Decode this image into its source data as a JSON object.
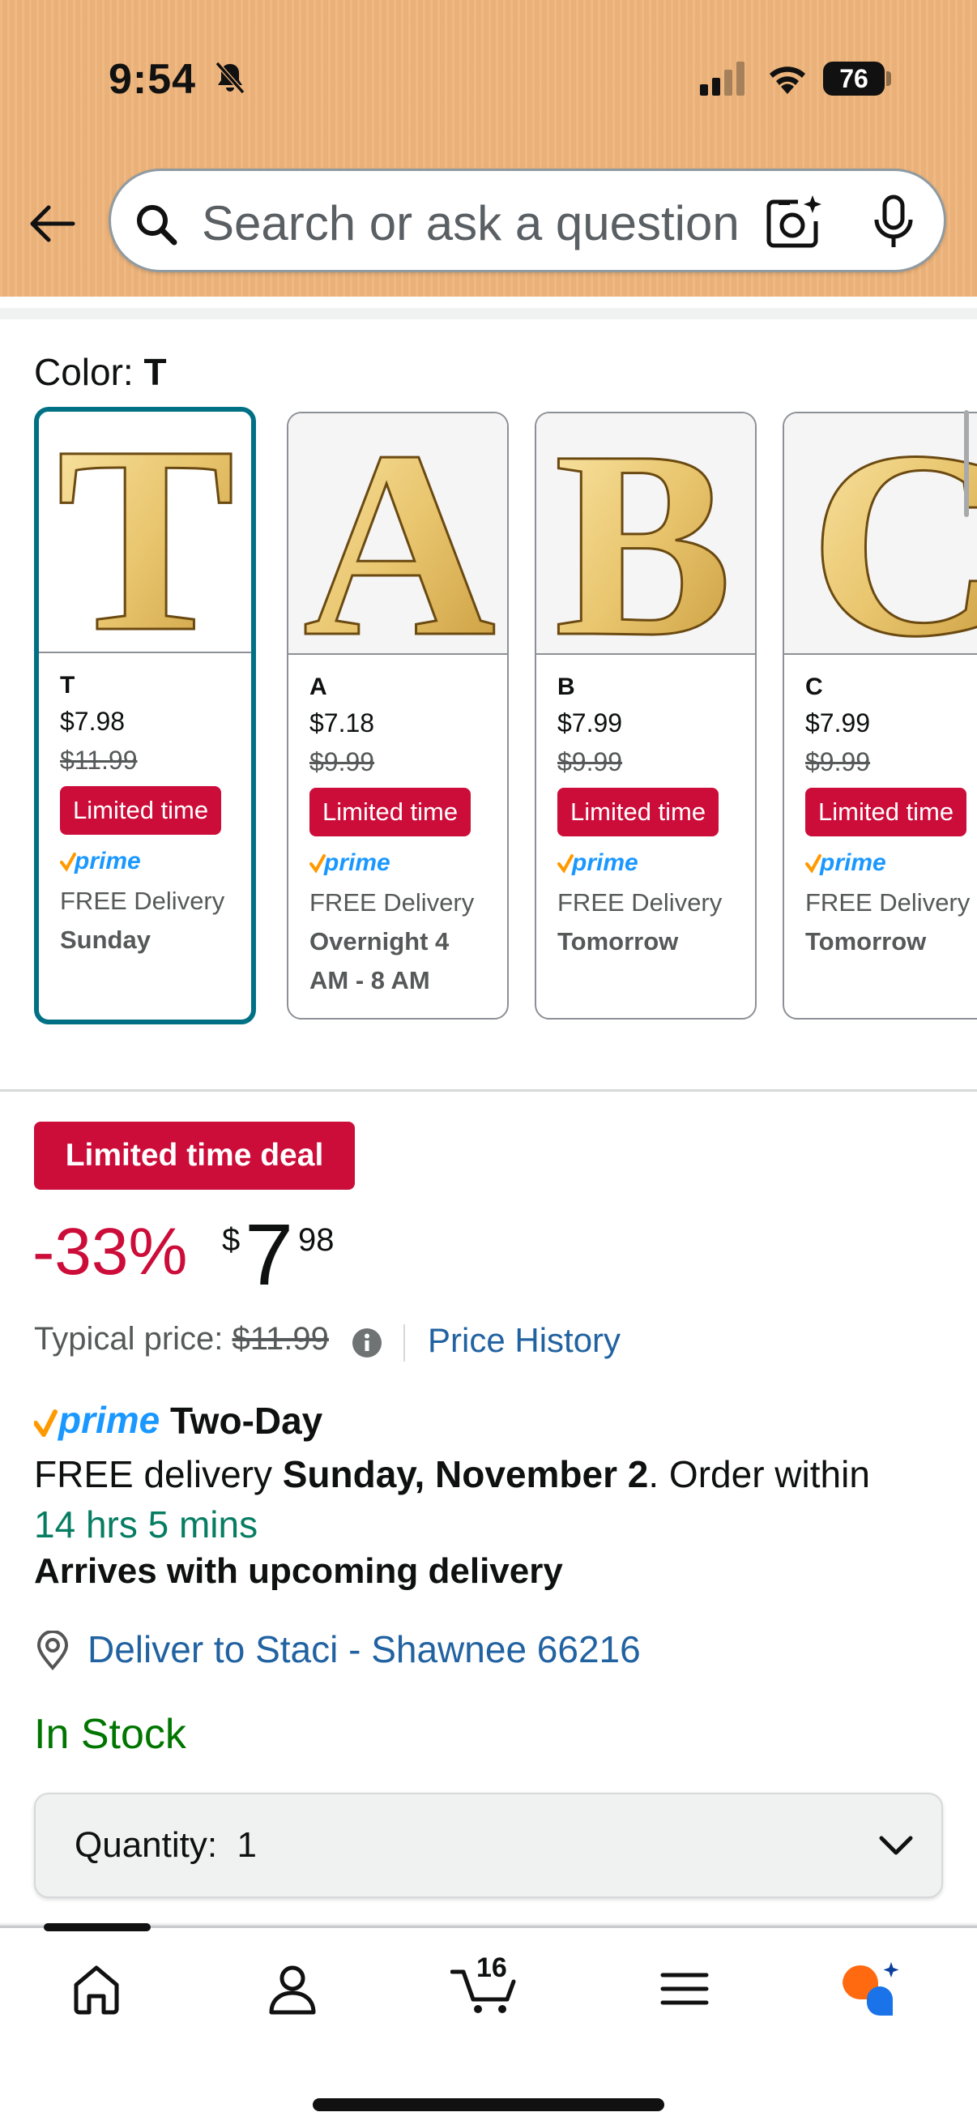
{
  "status_bar": {
    "time": "9:54",
    "battery": "76"
  },
  "search": {
    "placeholder": "Search or ask a question"
  },
  "color_selector": {
    "label": "Color: ",
    "selected": "T",
    "options": [
      {
        "name": "T",
        "price": "$7.98",
        "list_price": "$11.99",
        "badge": "Limited time",
        "prime": "prime",
        "delivery": "FREE Delivery",
        "delivery_date": "Sunday",
        "delivery_date_2": ""
      },
      {
        "name": "A",
        "price": "$7.18",
        "list_price": "$9.99",
        "badge": "Limited time",
        "prime": "prime",
        "delivery": "FREE Delivery",
        "delivery_date": "Overnight 4",
        "delivery_date_2": "AM - 8 AM"
      },
      {
        "name": "B",
        "price": "$7.99",
        "list_price": "$9.99",
        "badge": "Limited time",
        "prime": "prime",
        "delivery": "FREE Delivery",
        "delivery_date": "Tomorrow",
        "delivery_date_2": ""
      },
      {
        "name": "C",
        "price": "$7.99",
        "list_price": "$9.99",
        "badge": "Limited time",
        "prime": "prime",
        "delivery": "FREE Delivery",
        "delivery_date": "Tomorrow",
        "delivery_date_2": ""
      }
    ]
  },
  "deal": {
    "badge": "Limited time deal",
    "discount": "-33%",
    "price_symbol": "$",
    "price_whole": "7",
    "price_fraction": "98",
    "typical_label": "Typical price: ",
    "typical_price": "$11.99",
    "price_history": "Price History"
  },
  "delivery": {
    "prime_word": "prime",
    "prime_speed": "Two-Day",
    "free_prefix": "FREE delivery ",
    "date": "Sunday, November 2",
    "order_suffix": ". Order within",
    "countdown": "14 hrs 5 mins",
    "upcoming": "Arrives with upcoming delivery",
    "deliver_to": "Deliver to Staci - Shawnee 66216",
    "stock": "In Stock"
  },
  "quantity": {
    "label": "Quantity:",
    "value": "1"
  },
  "bottom_nav": {
    "cart_count": "16",
    "items": [
      "home",
      "account",
      "cart",
      "menu",
      "rufus"
    ]
  },
  "colors": {
    "header_bg": "#efb57c",
    "deal_red": "#cc0c39",
    "link_blue": "#2162a1",
    "selected_teal": "#007185",
    "stock_green": "#007600",
    "countdown_green": "#067d62",
    "prime_blue": "#1a98ff",
    "prime_orange": "#ff9900"
  }
}
